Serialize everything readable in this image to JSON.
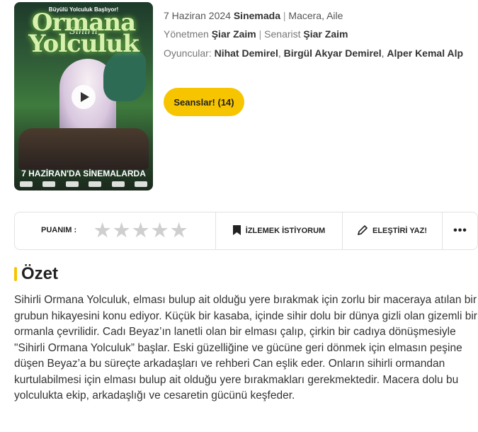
{
  "poster": {
    "tagline": "Büyülü Yolculuk Başlıyor!",
    "title": "Ormana Yolculuk",
    "subtitle": "Sihirli",
    "date_banner": "7 HAZİRAN'DA SİNEMALARDA"
  },
  "movie": {
    "release_date": "7 Haziran 2024",
    "release_place": "Sinemada",
    "genres": "Macera, Aile",
    "director_label": "Yönetmen",
    "director": "Şiar Zaim",
    "writer_label": "Senarist",
    "writer": "Şiar Zaim",
    "cast_label": "Oyuncular:",
    "cast": [
      "Nihat Demirel",
      "Birgül Akyar Demirel",
      "Alper Kemal Alp"
    ]
  },
  "buttons": {
    "showtimes": "Seanslar! (14)"
  },
  "actions": {
    "rating_label": "PUANIM :",
    "stars": 5,
    "watchlist": "İZLEMEK İSTİYORUM",
    "review": "ELEŞTİRİ YAZ!",
    "more": "•••"
  },
  "summary": {
    "heading": "Özet",
    "text": "Sihirli Ormana Yolculuk, elması bulup ait olduğu yere bırakmak için zorlu bir maceraya atılan bir grubun hikayesini konu ediyor. Küçük bir kasaba, içinde sihir dolu bir dünya gizli olan gizemli bir ormanla çevrilidir. Cadı Beyaz’ın lanetli olan bir elması çalıp, çirkin bir cadıya dönüşmesiyle \"Sihirli Ormana Yolculuk” başlar. Eski güzelliğine ve gücüne geri dönmek için elmasın peşine düşen Beyaz’a bu süreçte arkadaşları ve rehberi Can eşlik eder. Onların sihirli ormandan kurtulabilmesi için elması bulup ait olduğu yere bırakmakları gerekmektedir. Macera dolu bu yolculukta ekip, arkadaşlığı ve cesaretin gücünü keşfeder."
  },
  "colors": {
    "accent": "#f7c500"
  }
}
